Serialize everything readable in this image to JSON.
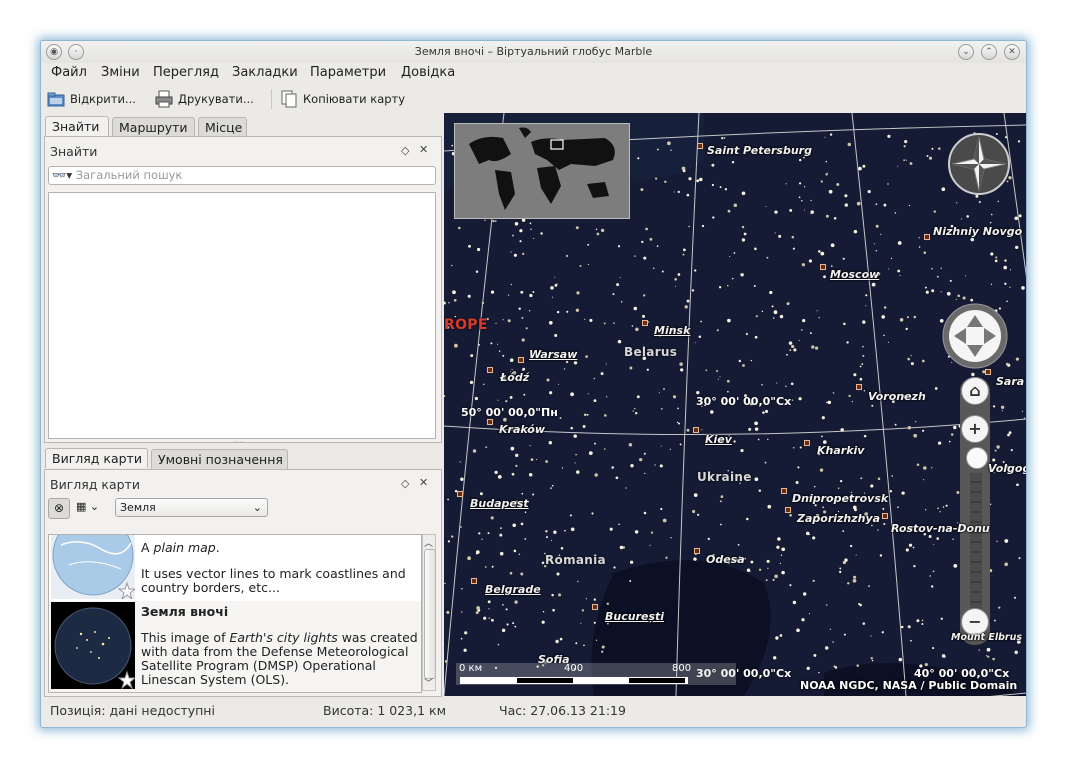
{
  "window": {
    "title": "Земля вночі – Віртуальний глобус Marble"
  },
  "menubar": {
    "items": [
      {
        "label": "Файл"
      },
      {
        "label": "Зміни"
      },
      {
        "label": "Перегляд"
      },
      {
        "label": "Закладки"
      },
      {
        "label": "Параметри"
      },
      {
        "label": "Довідка"
      }
    ]
  },
  "toolbar": {
    "open_label": "Відкрити...",
    "print_label": "Друкувати...",
    "copy_label": "Копіювати карту"
  },
  "top_tabs": [
    {
      "label": "Знайти",
      "active": true
    },
    {
      "label": "Маршрути",
      "active": false
    },
    {
      "label": "Місце",
      "active": false
    }
  ],
  "search_dock": {
    "title": "Знайти",
    "search_placeholder": "Загальний пошук"
  },
  "bottom_tabs": [
    {
      "label": "Вигляд карти",
      "active": true
    },
    {
      "label": "Умовні позначення",
      "active": false
    }
  ],
  "map_view_dock": {
    "title": "Вигляд карти",
    "celestial_body": "Земля"
  },
  "map_themes": [
    {
      "title_prefix": "A ",
      "title_em": "plain map",
      "title_suffix": ".",
      "description": "It uses vector lines to mark coastlines and country borders, etc..."
    },
    {
      "title": "Земля вночі",
      "desc_prefix": "This image of ",
      "desc_em": "Earth's city lights",
      "desc_suffix": " was created with data from the Defense Meteorological Satellite Program (DMSP) Operational Linescan System (OLS)."
    }
  ],
  "statusbar": {
    "position": "Позиція: дані недоступні",
    "altitude": "Висота:  1 023,1 км",
    "time": "Час: 27.06.13 21:19"
  },
  "map": {
    "cities": {
      "saint_petersburg": "Saint Petersburg",
      "nizhniy": "Nizhniy Novgo",
      "moscow": "Moscow",
      "minsk": "Minsk",
      "warsaw": "Warsaw",
      "lodz": "Łódź",
      "krakow": "Kraków",
      "kiev": "Kiev",
      "voronezh": "Voronezh",
      "kharkiv": "Kharkiv",
      "sara": "Sara",
      "volgog": "Volgog",
      "budapest": "Budapest",
      "dnipro": "Dnipropetrovsk",
      "zaporizh": "Zaporizhzhya",
      "rostov": "Rostov-na-Donu",
      "odesa": "Odesa",
      "belgrade": "Belgrade",
      "bucuresti": "București",
      "sofia": "Sofia",
      "elbrus": "Mount Elbrus"
    },
    "countries": {
      "belarus": "Belarus",
      "ukraine": "Ukraine",
      "romania": "Romania",
      "europe": "ROPE"
    },
    "grid_labels": {
      "lat50": "50° 00' 00,0\"Пн",
      "lon30": "30° 00' 00,0\"Сх",
      "lon30b": "30° 00' 00,0\"Сх",
      "lon40": "40° 00' 00,0\"Сх"
    },
    "scale": {
      "zero": "0 км",
      "mid": "400",
      "end": "800"
    },
    "attribution": "NOAA NGDC, NASA / Public Domain"
  }
}
